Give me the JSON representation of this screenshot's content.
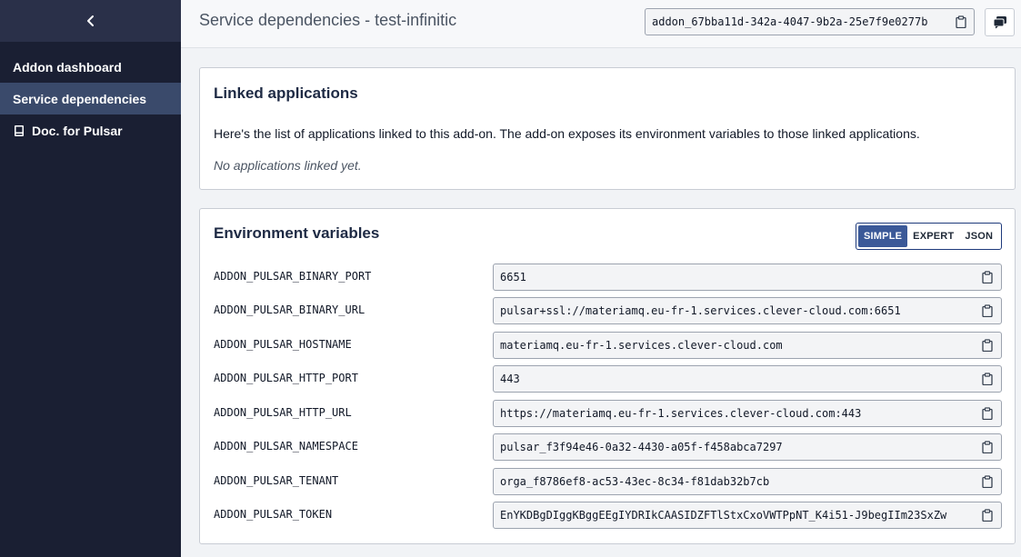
{
  "sidebar": {
    "back_icon": "chevron-left-icon",
    "items": [
      {
        "label": "Addon dashboard",
        "active": false
      },
      {
        "label": "Service dependencies",
        "active": true
      },
      {
        "label": "Doc. for Pulsar",
        "icon": "book-icon",
        "active": false
      }
    ]
  },
  "header": {
    "title": "Service dependencies - test-infinitic",
    "addon_id": "addon_67bba11d-342a-4047-9b2a-25e7f9e0277b",
    "copy_icon": "clipboard-icon",
    "chat_icon": "chat-icon"
  },
  "linked_apps": {
    "title": "Linked applications",
    "description": "Here's the list of applications linked to this add-on. The add-on exposes its environment variables to those linked applications.",
    "empty_text": "No applications linked yet."
  },
  "env": {
    "title": "Environment variables",
    "modes": [
      "SIMPLE",
      "EXPERT",
      "JSON"
    ],
    "selected_mode": "SIMPLE",
    "vars": [
      {
        "name": "ADDON_PULSAR_BINARY_PORT",
        "value": "6651"
      },
      {
        "name": "ADDON_PULSAR_BINARY_URL",
        "value": "pulsar+ssl://materiamq.eu-fr-1.services.clever-cloud.com:6651"
      },
      {
        "name": "ADDON_PULSAR_HOSTNAME",
        "value": "materiamq.eu-fr-1.services.clever-cloud.com"
      },
      {
        "name": "ADDON_PULSAR_HTTP_PORT",
        "value": "443"
      },
      {
        "name": "ADDON_PULSAR_HTTP_URL",
        "value": "https://materiamq.eu-fr-1.services.clever-cloud.com:443"
      },
      {
        "name": "ADDON_PULSAR_NAMESPACE",
        "value": "pulsar_f3f94e46-0a32-4430-a05f-f458abca7297"
      },
      {
        "name": "ADDON_PULSAR_TENANT",
        "value": "orga_f8786ef8-ac53-43ec-8c34-f81dab32b7cb"
      },
      {
        "name": "ADDON_PULSAR_TOKEN",
        "value": "EnYKDBgDIggKBggEEgIYDRIkCAASIDZFTlStxCxoVWTPpNT_K4i51-J9begIIm23SxZw"
      }
    ]
  },
  "colors": {
    "sidebar_bg": "#1a1f33",
    "sidebar_active": "#3a4a6b",
    "accent": "#3b5998"
  }
}
